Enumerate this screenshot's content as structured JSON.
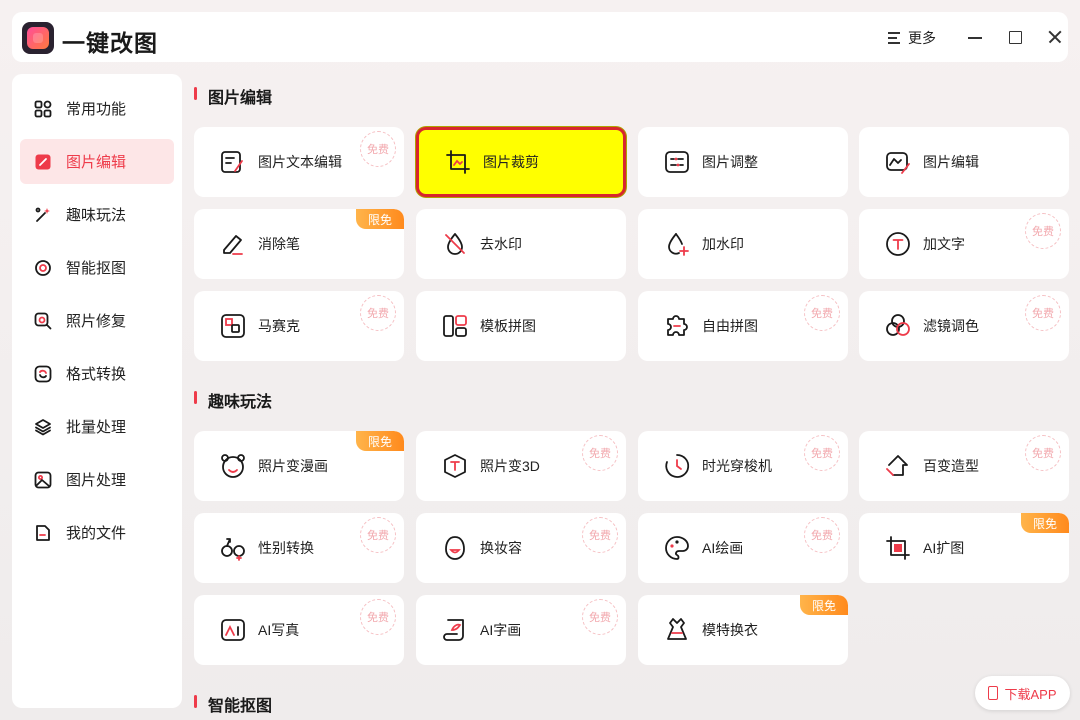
{
  "app": {
    "title": "一键改图",
    "more_label": "更多"
  },
  "sidebar": {
    "items": [
      {
        "label": "常用功能",
        "icon": "grid-icon",
        "active": false
      },
      {
        "label": "图片编辑",
        "icon": "edit-icon",
        "active": true
      },
      {
        "label": "趣味玩法",
        "icon": "magic-wand-icon",
        "active": false
      },
      {
        "label": "智能抠图",
        "icon": "target-icon",
        "active": false
      },
      {
        "label": "照片修复",
        "icon": "magnifier-icon",
        "active": false
      },
      {
        "label": "格式转换",
        "icon": "convert-icon",
        "active": false
      },
      {
        "label": "批量处理",
        "icon": "layers-icon",
        "active": false
      },
      {
        "label": "图片处理",
        "icon": "image-icon",
        "active": false
      },
      {
        "label": "我的文件",
        "icon": "file-icon",
        "active": false
      }
    ]
  },
  "sections": [
    {
      "title": "图片编辑",
      "cards": [
        {
          "label": "图片文本编辑",
          "icon": "text-edit-icon",
          "tag": "免费",
          "tag_type": "stamp"
        },
        {
          "label": "图片裁剪",
          "icon": "crop-icon",
          "tag": "",
          "tag_type": "none",
          "highlight": true
        },
        {
          "label": "图片调整",
          "icon": "adjust-icon",
          "tag": "",
          "tag_type": "none"
        },
        {
          "label": "图片编辑",
          "icon": "image-edit-icon",
          "tag": "",
          "tag_type": "none"
        },
        {
          "label": "消除笔",
          "icon": "eraser-pen-icon",
          "tag": "限免",
          "tag_type": "badge"
        },
        {
          "label": "去水印",
          "icon": "remove-watermark-icon",
          "tag": "",
          "tag_type": "none"
        },
        {
          "label": "加水印",
          "icon": "add-watermark-icon",
          "tag": "",
          "tag_type": "none"
        },
        {
          "label": "加文字",
          "icon": "add-text-icon",
          "tag": "免费",
          "tag_type": "stamp"
        },
        {
          "label": "马赛克",
          "icon": "mosaic-icon",
          "tag": "免费",
          "tag_type": "stamp"
        },
        {
          "label": "模板拼图",
          "icon": "template-collage-icon",
          "tag": "",
          "tag_type": "none"
        },
        {
          "label": "自由拼图",
          "icon": "puzzle-icon",
          "tag": "免费",
          "tag_type": "stamp"
        },
        {
          "label": "滤镜调色",
          "icon": "filter-icon",
          "tag": "免费",
          "tag_type": "stamp"
        }
      ]
    },
    {
      "title": "趣味玩法",
      "cards": [
        {
          "label": "照片变漫画",
          "icon": "cartoon-face-icon",
          "tag": "限免",
          "tag_type": "badge"
        },
        {
          "label": "照片变3D",
          "icon": "cube-icon",
          "tag": "免费",
          "tag_type": "stamp"
        },
        {
          "label": "时光穿梭机",
          "icon": "time-machine-icon",
          "tag": "免费",
          "tag_type": "stamp"
        },
        {
          "label": "百变造型",
          "icon": "style-icon",
          "tag": "免费",
          "tag_type": "stamp"
        },
        {
          "label": "性别转换",
          "icon": "gender-icon",
          "tag": "免费",
          "tag_type": "stamp"
        },
        {
          "label": "换妆容",
          "icon": "makeup-icon",
          "tag": "免费",
          "tag_type": "stamp"
        },
        {
          "label": "AI绘画",
          "icon": "palette-icon",
          "tag": "免费",
          "tag_type": "stamp"
        },
        {
          "label": "AI扩图",
          "icon": "expand-icon",
          "tag": "限免",
          "tag_type": "badge"
        },
        {
          "label": "AI写真",
          "icon": "portrait-icon",
          "tag": "免费",
          "tag_type": "stamp"
        },
        {
          "label": "AI字画",
          "icon": "scroll-icon",
          "tag": "免费",
          "tag_type": "stamp"
        },
        {
          "label": "模特换衣",
          "icon": "dress-icon",
          "tag": "限免",
          "tag_type": "badge"
        }
      ]
    },
    {
      "title": "智能抠图",
      "cards": []
    }
  ],
  "download": {
    "label": "下载APP"
  },
  "colors": {
    "accent": "#ee3b4a",
    "badge": "#ff9a2e",
    "highlight_fill": "#ffff00",
    "highlight_border": "#d7262e"
  }
}
